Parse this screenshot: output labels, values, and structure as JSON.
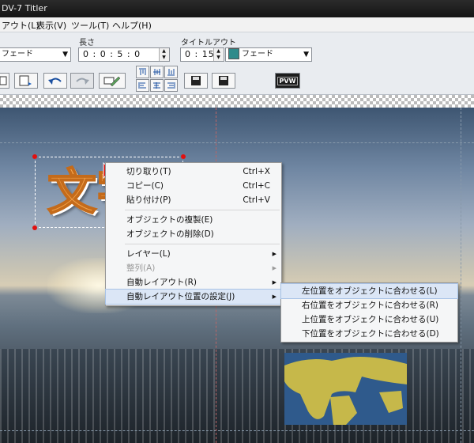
{
  "window": {
    "title": "DV-7 Titler"
  },
  "menubar": [
    "アウト(L)",
    "表示(V)",
    "ツール(T)",
    "ヘルプ(H)"
  ],
  "toolbar": {
    "transition_in_value": "フェード",
    "length_label": "長さ",
    "length_value": "0 : 0 : 5 : 0",
    "title_out_label": "タイトルアウト",
    "title_out_time": "0 : 15",
    "title_out_transition": "フェード",
    "pvw_label": "PVW"
  },
  "canvas": {
    "title_text": "文字"
  },
  "context_menu": {
    "items": [
      {
        "label": "切り取り(T)",
        "shortcut": "Ctrl+X"
      },
      {
        "label": "コピー(C)",
        "shortcut": "Ctrl+C"
      },
      {
        "label": "貼り付け(P)",
        "shortcut": "Ctrl+V"
      },
      {
        "label": "オブジェクトの複製(E)"
      },
      {
        "label": "オブジェクトの削除(D)"
      },
      {
        "label": "レイヤー(L)"
      },
      {
        "label": "整列(A)"
      },
      {
        "label": "自動レイアウト(R)"
      },
      {
        "label": "自動レイアウト位置の設定(J)"
      }
    ]
  },
  "submenu": {
    "items": [
      {
        "label": "左位置をオブジェクトに合わせる(L)"
      },
      {
        "label": "右位置をオブジェクトに合わせる(R)"
      },
      {
        "label": "上位置をオブジェクトに合わせる(U)"
      },
      {
        "label": "下位置をオブジェクトに合わせる(D)"
      }
    ]
  },
  "colors": {
    "accent": "#dbe6f6",
    "text_orange": "#f2a24a",
    "cursor_red": "#e01010"
  }
}
